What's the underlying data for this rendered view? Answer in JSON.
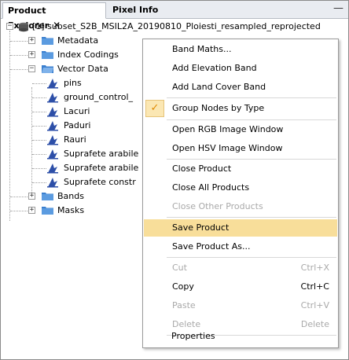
{
  "tabs": {
    "product_explorer": "Product Explorer",
    "pixel_info": "Pixel Info",
    "close_glyph": "✕",
    "minimize_glyph": "—"
  },
  "tree": {
    "root_label": "[1] subset_S2B_MSIL2A_20190810_Ploiesti_resampled_reprojected",
    "metadata": "Metadata",
    "index_codings": "Index Codings",
    "vector_data": "Vector Data",
    "vector_items": [
      "pins",
      "ground_control_",
      "Lacuri",
      "Paduri",
      "Rauri",
      "Suprafete arabile",
      "Suprafete arabile",
      "Suprafete constr"
    ],
    "bands": "Bands",
    "masks": "Masks"
  },
  "menu": {
    "band_maths": "Band Maths...",
    "add_elevation": "Add Elevation Band",
    "add_land_cover": "Add Land Cover Band",
    "group_nodes": "Group Nodes by Type",
    "open_rgb": "Open RGB Image Window",
    "open_hsv": "Open HSV Image Window",
    "close_product": "Close Product",
    "close_all": "Close All Products",
    "close_other": "Close Other Products",
    "save_product": "Save Product",
    "save_product_as": "Save Product As...",
    "cut": "Cut",
    "cut_sc": "Ctrl+X",
    "copy": "Copy",
    "copy_sc": "Ctrl+C",
    "paste": "Paste",
    "paste_sc": "Ctrl+V",
    "delete": "Delete",
    "delete_sc": "Delete",
    "properties": "Properties",
    "check_glyph": "✓"
  },
  "colors": {
    "highlight": "#f8de9a",
    "folder": "#3a7fcf",
    "vector_icon": "#2d4fa8"
  }
}
